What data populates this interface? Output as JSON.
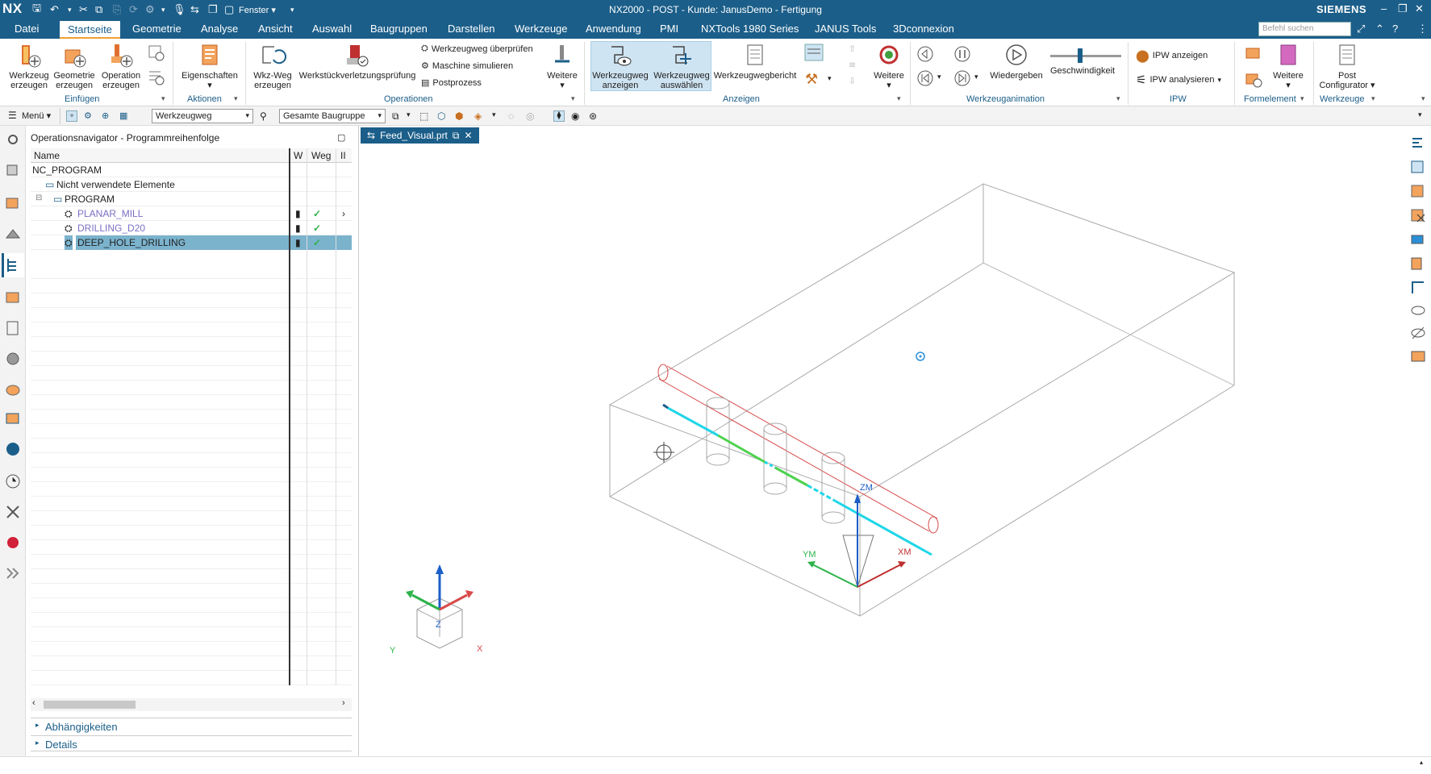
{
  "app": {
    "logo": "NX",
    "title": "NX2000 - POST - Kunde: JanusDemo - Fertigung",
    "brand": "SIEMENS",
    "window_menu": "Fenster ▾"
  },
  "menu_tabs": [
    "Datei",
    "Startseite",
    "Geometrie",
    "Analyse",
    "Ansicht",
    "Auswahl",
    "Baugruppen",
    "Darstellen",
    "Werkzeuge",
    "Anwendung",
    "PMI",
    "NXTools 1980 Series",
    "JANUS Tools",
    "3Dconnexion"
  ],
  "search_placeholder": "Befehl suchen",
  "ribbon": {
    "werkzeug_erzeugen": [
      "Werkzeug",
      "erzeugen"
    ],
    "geometrie_erzeugen": [
      "Geometrie",
      "erzeugen"
    ],
    "operation_erzeugen": [
      "Operation",
      "erzeugen"
    ],
    "eigenschaften": "Eigenschaften",
    "wkz_weg_erzeugen": [
      "Wkz-Weg",
      "erzeugen"
    ],
    "werkstueckverletzung": "Werkstückverletzungsprüfung",
    "ueberpruefen": "Werkzeugweg überprüfen",
    "simulieren": "Maschine simulieren",
    "postprozess": "Postprozess",
    "weitere": "Weitere",
    "werkzeugweg_anzeigen": [
      "Werkzeugweg",
      "anzeigen"
    ],
    "werkzeugweg_auswaehlen": [
      "Werkzeugweg",
      "auswählen"
    ],
    "werkzeugwegbericht": "Werkzeugwegbericht",
    "weitere2": "Weitere",
    "wiedergeben": "Wiedergeben",
    "geschwindigkeit": "Geschwindigkeit",
    "ipw_anzeigen": "IPW anzeigen",
    "ipw_analysieren": "IPW analysieren",
    "weitere3": "Weitere",
    "post_configurator": [
      "Post",
      "Configurator ▾"
    ],
    "groups": {
      "einfuegen": "Einfügen",
      "aktionen": "Aktionen",
      "operationen": "Operationen",
      "anzeigen": "Anzeigen",
      "animation": "Werkzeuganimation",
      "ipw": "IPW",
      "formelement": "Formelement",
      "werkzeuge": "Werkzeuge"
    }
  },
  "toolbar2": {
    "menu": "Menü ▾",
    "filter_value": "Werkzeugweg",
    "assembly_value": "Gesamte Baugruppe"
  },
  "navigator": {
    "title": "Operationsnavigator - Programmreihenfolge",
    "columns": [
      "Name",
      "W",
      "Weg",
      "II"
    ],
    "rows": [
      {
        "name": "NC_PROGRAM",
        "indent": 0
      },
      {
        "name": "Nicht verwendete Elemente",
        "indent": 1
      },
      {
        "name": "PROGRAM",
        "indent": 2
      },
      {
        "name": "PLANAR_MILL",
        "indent": 3
      },
      {
        "name": "DRILLING_D20",
        "indent": 3
      },
      {
        "name": "DEEP_HOLE_DRILLING",
        "indent": 3
      }
    ],
    "sections": [
      "Abhängigkeiten",
      "Details"
    ]
  },
  "viewport": {
    "doc_tab": "Feed_Visual.prt",
    "axes_wcs": {
      "x": "XM",
      "y": "YM",
      "z": "ZM"
    },
    "axes_triad": {
      "x": "X",
      "y": "Y",
      "z": "Z"
    }
  },
  "colors": {
    "titlebar": "#1b5e89",
    "selected_row": "#7bb3cd",
    "op_text": "#7a6fc4",
    "check": "#2db34a",
    "toolpath_cyan": "#1fd6e8",
    "toolpath_green": "#4ed24e",
    "hole_outline": "#d94a4a"
  }
}
